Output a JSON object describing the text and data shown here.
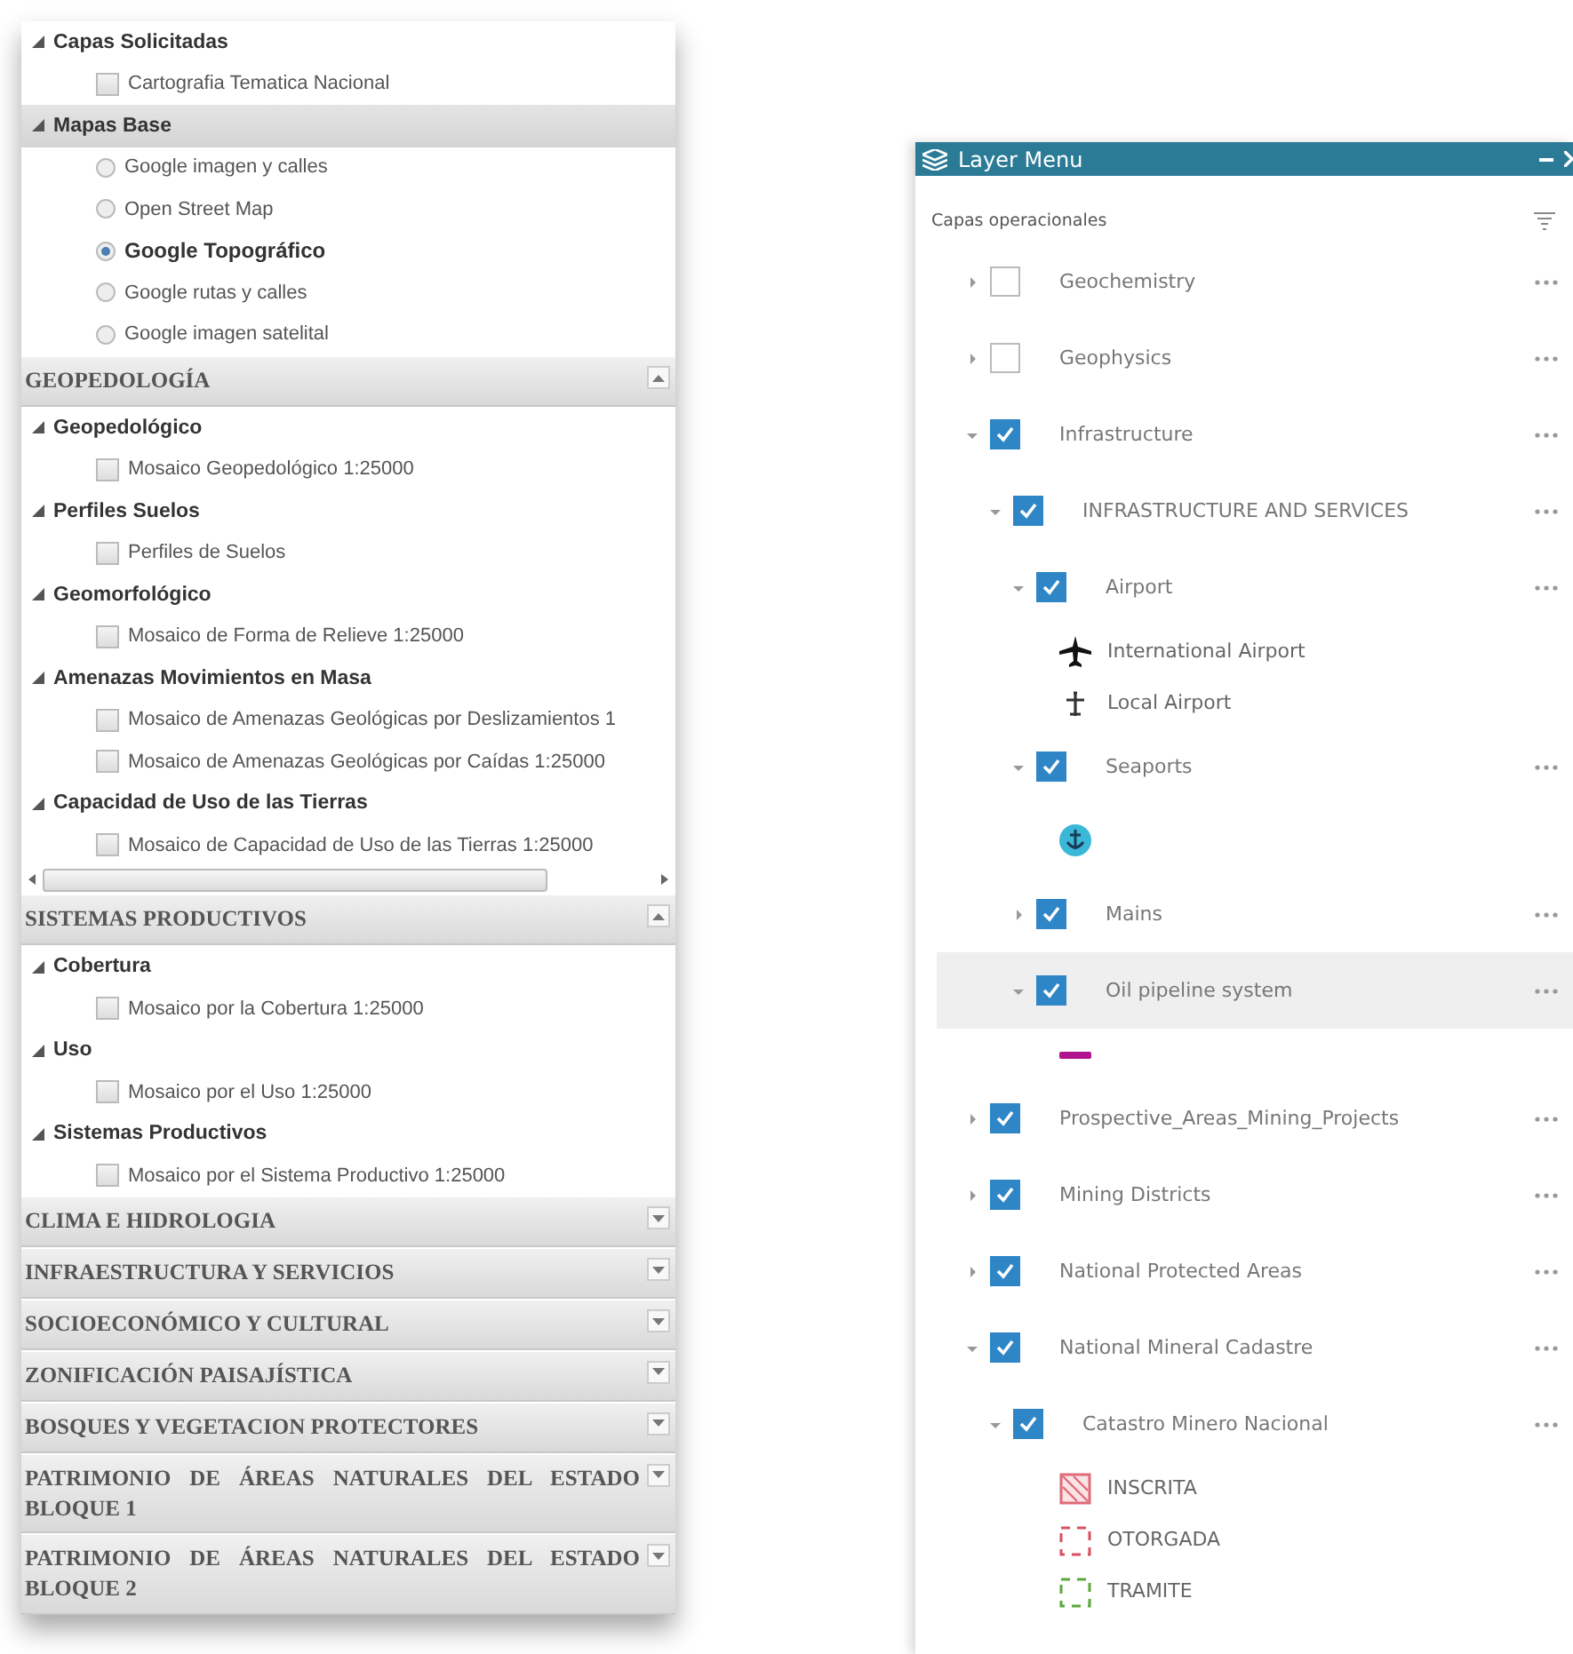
{
  "left_panel": {
    "sections": [
      {
        "items": [
          {
            "kind": "group",
            "label": "Capas Solicitadas",
            "expanded": true,
            "selected": false,
            "children": [
              {
                "kind": "checkbox",
                "label": "Cartografia Tematica Nacional",
                "checked": false
              }
            ]
          },
          {
            "kind": "group",
            "label": "Mapas Base",
            "expanded": true,
            "selected": true,
            "children": [
              {
                "kind": "radio",
                "label": "Google imagen y calles",
                "selected": false
              },
              {
                "kind": "radio",
                "label": "Open Street Map",
                "selected": false
              },
              {
                "kind": "radio",
                "label": "Google Topográfico",
                "selected": true
              },
              {
                "kind": "radio",
                "label": "Google rutas y calles",
                "selected": false
              },
              {
                "kind": "radio",
                "label": "Google imagen satelital",
                "selected": false
              }
            ]
          }
        ]
      },
      {
        "header": {
          "title": "GEOPEDOLOGÍA",
          "expanded": true
        },
        "items": [
          {
            "kind": "group",
            "label": "Geopedológico",
            "expanded": true,
            "selected": false,
            "children": [
              {
                "kind": "checkbox",
                "label": "Mosaico Geopedológico 1:25000",
                "checked": false
              }
            ]
          },
          {
            "kind": "group",
            "label": "Perfiles Suelos",
            "expanded": true,
            "selected": false,
            "children": [
              {
                "kind": "checkbox",
                "label": "Perfiles de Suelos",
                "checked": false
              }
            ]
          },
          {
            "kind": "group",
            "label": "Geomorfológico",
            "expanded": true,
            "selected": false,
            "children": [
              {
                "kind": "checkbox",
                "label": "Mosaico de Forma de Relieve 1:25000",
                "checked": false
              }
            ]
          },
          {
            "kind": "group",
            "label": "Amenazas Movimientos en Masa",
            "expanded": true,
            "selected": false,
            "children": [
              {
                "kind": "checkbox",
                "label": "Mosaico de Amenazas Geológicas por Deslizamientos 1",
                "checked": false
              },
              {
                "kind": "checkbox",
                "label": "Mosaico de Amenazas Geológicas por Caídas 1:25000",
                "checked": false
              }
            ]
          },
          {
            "kind": "group",
            "label": "Capacidad de Uso de las Tierras",
            "expanded": true,
            "selected": false,
            "children": [
              {
                "kind": "checkbox",
                "label": "Mosaico de Capacidad de Uso de las Tierras 1:25000",
                "checked": false
              }
            ]
          },
          {
            "kind": "scrollbar"
          }
        ]
      },
      {
        "header": {
          "title": "SISTEMAS PRODUCTIVOS",
          "expanded": true
        },
        "items": [
          {
            "kind": "group",
            "label": "Cobertura",
            "expanded": true,
            "selected": false,
            "children": [
              {
                "kind": "checkbox",
                "label": "Mosaico por la Cobertura 1:25000",
                "checked": false
              }
            ]
          },
          {
            "kind": "group",
            "label": "Uso",
            "expanded": true,
            "selected": false,
            "children": [
              {
                "kind": "checkbox",
                "label": "Mosaico por el Uso 1:25000",
                "checked": false
              }
            ]
          },
          {
            "kind": "group",
            "label": "Sistemas Productivos",
            "expanded": true,
            "selected": false,
            "children": [
              {
                "kind": "checkbox",
                "label": "Mosaico por el Sistema Productivo 1:25000",
                "checked": false
              }
            ]
          }
        ]
      },
      {
        "header": {
          "title": "CLIMA E HIDROLOGIA",
          "expanded": false
        }
      },
      {
        "header": {
          "title": "INFRAESTRUCTURA Y SERVICIOS",
          "expanded": false
        }
      },
      {
        "header": {
          "title": "SOCIOECONÓMICO Y CULTURAL",
          "expanded": false
        }
      },
      {
        "header": {
          "title": "ZONIFICACIÓN PAISAJÍSTICA",
          "expanded": false
        }
      },
      {
        "header": {
          "title": "BOSQUES Y VEGETACION PROTECTORES",
          "expanded": false
        }
      },
      {
        "header": {
          "title": "PATRIMONIO DE ÁREAS NATURALES DEL ESTADO BLOQUE 1",
          "expanded": false
        }
      },
      {
        "header": {
          "title": "PATRIMONIO DE ÁREAS NATURALES DEL ESTADO BLOQUE 2",
          "expanded": false
        }
      }
    ]
  },
  "layer_menu": {
    "window": {
      "title": "Layer Menu"
    },
    "heading": "Capas operacionales",
    "layers": [
      {
        "label": "Geochemistry",
        "expanded": false,
        "checked": false,
        "selected": false
      },
      {
        "label": "Geophysics",
        "expanded": false,
        "checked": false,
        "selected": false
      },
      {
        "label": "Infrastructure",
        "expanded": true,
        "checked": true,
        "selected": false,
        "children": [
          {
            "label": "INFRASTRUCTURE AND SERVICES",
            "expanded": true,
            "checked": true,
            "selected": false,
            "children": [
              {
                "label": "Airport",
                "expanded": true,
                "checked": true,
                "selected": false,
                "legend": [
                  {
                    "kind": "plane-large",
                    "label": "International Airport",
                    "color": "#111111"
                  },
                  {
                    "kind": "plane-small",
                    "label": "Local Airport",
                    "color": "#333333"
                  }
                ]
              },
              {
                "label": "Seaports",
                "expanded": true,
                "checked": true,
                "selected": false,
                "legend": [
                  {
                    "kind": "anchor",
                    "color": "#3bb8d8"
                  }
                ]
              },
              {
                "label": "Mains",
                "expanded": false,
                "checked": true,
                "selected": false
              },
              {
                "label": "Oil pipeline system",
                "expanded": true,
                "checked": true,
                "selected": true,
                "legend": [
                  {
                    "kind": "line",
                    "color": "#b0158f"
                  }
                ]
              }
            ]
          }
        ]
      },
      {
        "label": "Prospective_Areas_Mining_Projects",
        "expanded": false,
        "checked": true,
        "selected": false
      },
      {
        "label": "Mining Districts",
        "expanded": false,
        "checked": true,
        "selected": false
      },
      {
        "label": "National Protected Areas",
        "expanded": false,
        "checked": true,
        "selected": false
      },
      {
        "label": "National Mineral Cadastre",
        "expanded": true,
        "checked": true,
        "selected": false,
        "children": [
          {
            "label": "Catastro Minero Nacional",
            "expanded": true,
            "checked": true,
            "selected": false,
            "legend": [
              {
                "kind": "hatched-box",
                "label": "INSCRITA",
                "color": "#e06a78"
              },
              {
                "kind": "dashed-box",
                "label": "OTORGADA",
                "color": "#d9505f"
              },
              {
                "kind": "dashed-box",
                "label": "TRAMITE",
                "color": "#5aa83c"
              }
            ]
          }
        ]
      }
    ]
  }
}
